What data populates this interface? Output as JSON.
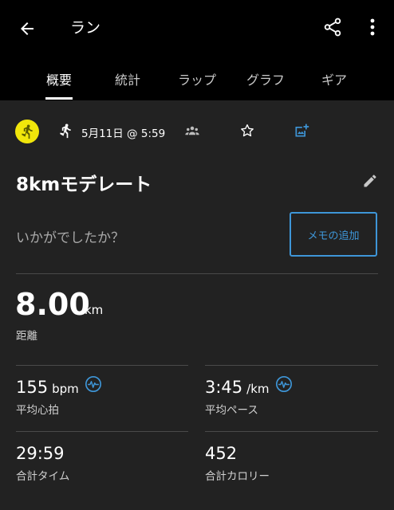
{
  "header": {
    "title": "ラン"
  },
  "tabs": [
    {
      "label": "概要",
      "active": true
    },
    {
      "label": "統計",
      "active": false
    },
    {
      "label": "ラップ",
      "active": false
    },
    {
      "label": "グラフ",
      "active": false
    },
    {
      "label": "ギア",
      "active": false
    }
  ],
  "activity": {
    "date_time": "5月11日 @ 5:59",
    "name": "8kmモデレート",
    "memo_prompt": "いかがでしたか？",
    "memo_button": "メモの追加"
  },
  "distance": {
    "value": "8.00",
    "unit": "km",
    "label": "距離"
  },
  "stats": {
    "heart_rate": {
      "value": "155",
      "unit": "bpm",
      "label": "平均心拍"
    },
    "pace": {
      "value": "3:45",
      "unit": "/km",
      "label": "平均ペース"
    },
    "time": {
      "value": "29:59",
      "label": "合計タイム"
    },
    "calories": {
      "value": "452",
      "label": "合計カロリー"
    }
  },
  "colors": {
    "accent": "#3e96d8",
    "avatar": "#f1e60b",
    "background": "#222222",
    "header": "#000000"
  },
  "icons": [
    "back-arrow-icon",
    "share-icon",
    "more-vert-icon",
    "run-icon",
    "people-icon",
    "star-icon",
    "add-photo-icon",
    "pencil-icon",
    "pulse-icon"
  ]
}
